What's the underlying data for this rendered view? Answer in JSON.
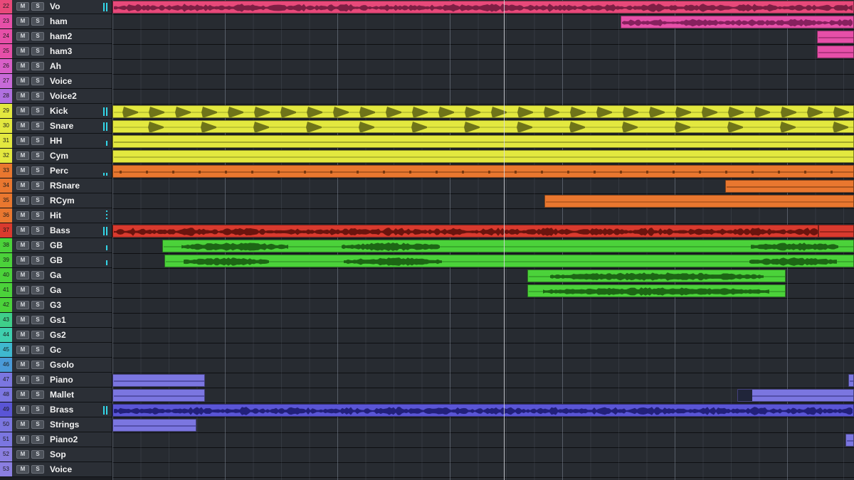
{
  "colors": {
    "vocal": "#e8497a",
    "vocal_wave": "#7e1f44",
    "harmony": "#e64fa8",
    "harmony_wave": "#86215e",
    "drums": "#e3e83f",
    "drums_wave": "#6f7419",
    "perc": "#e9772f",
    "perc_wave": "#7a3a10",
    "bass": "#d93a2e",
    "bass_wave": "#6b140e",
    "guitar": "#4bd23a",
    "guitar_wave": "#1d6615",
    "keys": "#7b76e0",
    "keys_wave": "#353080",
    "brass": "#5a55d6",
    "brass_wave": "#22207a"
  },
  "tracks": [
    {
      "num": "22",
      "name": "Vo",
      "color": "#e8497a",
      "meter": "2"
    },
    {
      "num": "23",
      "name": "ham",
      "color": "#e64fa8",
      "meter": ""
    },
    {
      "num": "24",
      "name": "ham2",
      "color": "#e64fa8",
      "meter": ""
    },
    {
      "num": "25",
      "name": "ham3",
      "color": "#e64fa8",
      "meter": ""
    },
    {
      "num": "26",
      "name": "Ah",
      "color": "#d95fc8",
      "meter": ""
    },
    {
      "num": "27",
      "name": "Voice",
      "color": "#c86ad8",
      "meter": ""
    },
    {
      "num": "28",
      "name": "Voice2",
      "color": "#b070e0",
      "meter": ""
    },
    {
      "num": "29",
      "name": "Kick",
      "color": "#e3e83f",
      "meter": "2"
    },
    {
      "num": "30",
      "name": "Snare",
      "color": "#e3e83f",
      "meter": "2"
    },
    {
      "num": "31",
      "name": "HH",
      "color": "#e3e83f",
      "meter": "1"
    },
    {
      "num": "32",
      "name": "Cym",
      "color": "#e3e83f",
      "meter": ""
    },
    {
      "num": "33",
      "name": "Perc",
      "color": "#e9772f",
      "meter": "s"
    },
    {
      "num": "34",
      "name": "RSnare",
      "color": "#e9772f",
      "meter": ""
    },
    {
      "num": "35",
      "name": "RCym",
      "color": "#e9772f",
      "meter": ""
    },
    {
      "num": "36",
      "name": "Hit",
      "color": "#e9772f",
      "meter": "d"
    },
    {
      "num": "37",
      "name": "Bass",
      "color": "#d93a2e",
      "meter": "2"
    },
    {
      "num": "38",
      "name": "GB",
      "color": "#4bd23a",
      "meter": "1"
    },
    {
      "num": "39",
      "name": "GB",
      "color": "#4bd23a",
      "meter": "1"
    },
    {
      "num": "40",
      "name": "Ga",
      "color": "#4bd23a",
      "meter": ""
    },
    {
      "num": "41",
      "name": "Ga",
      "color": "#4bd23a",
      "meter": ""
    },
    {
      "num": "42",
      "name": "G3",
      "color": "#4bd23a",
      "meter": ""
    },
    {
      "num": "43",
      "name": "Gs1",
      "color": "#3fcf8a",
      "meter": ""
    },
    {
      "num": "44",
      "name": "Gs2",
      "color": "#3fcfae",
      "meter": ""
    },
    {
      "num": "45",
      "name": "Gc",
      "color": "#3fb8cf",
      "meter": ""
    },
    {
      "num": "46",
      "name": "Gsolo",
      "color": "#4a9ad8",
      "meter": ""
    },
    {
      "num": "47",
      "name": "Piano",
      "color": "#7b76e0",
      "meter": ""
    },
    {
      "num": "48",
      "name": "Mallet",
      "color": "#7b76e0",
      "meter": ""
    },
    {
      "num": "49",
      "name": "Brass",
      "color": "#5a55d6",
      "meter": "2"
    },
    {
      "num": "50",
      "name": "Strings",
      "color": "#7b76e0",
      "meter": ""
    },
    {
      "num": "51",
      "name": "Piano2",
      "color": "#7b76e0",
      "meter": ""
    },
    {
      "num": "52",
      "name": "Sop",
      "color": "#8a7ee0",
      "meter": ""
    },
    {
      "num": "53",
      "name": "Voice",
      "color": "#8a7ee0",
      "meter": ""
    }
  ],
  "buttons": {
    "mute": "M",
    "solo": "S"
  },
  "playhead": {
    "position_ratio": 0.528
  }
}
